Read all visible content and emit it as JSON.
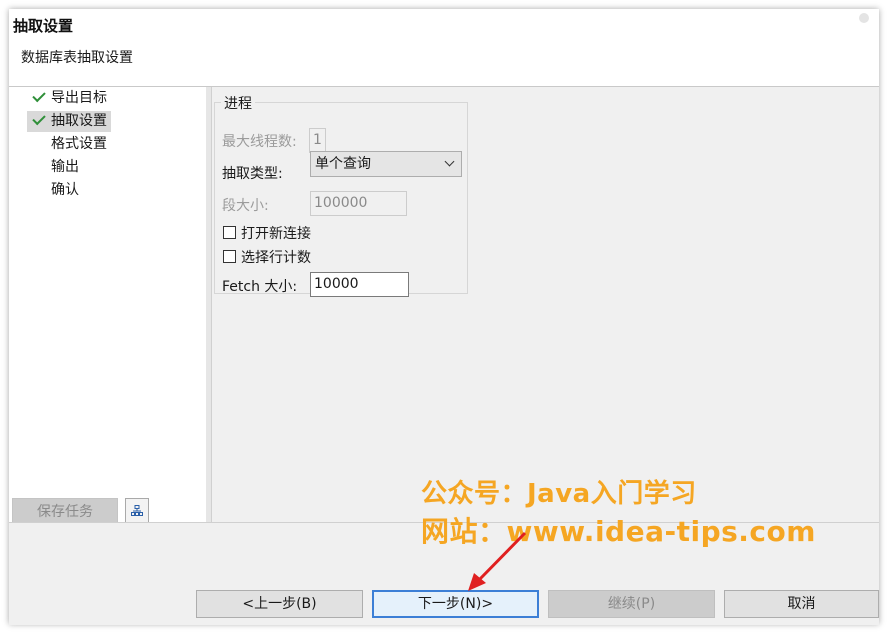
{
  "header": {
    "title": "抽取设置",
    "subtitle": "数据库表抽取设置"
  },
  "nav": {
    "items": [
      {
        "label": "导出目标",
        "checked": true,
        "selected": false
      },
      {
        "label": "抽取设置",
        "checked": true,
        "selected": true
      },
      {
        "label": "格式设置",
        "checked": false,
        "selected": false
      },
      {
        "label": "输出",
        "checked": false,
        "selected": false
      },
      {
        "label": "确认",
        "checked": false,
        "selected": false
      }
    ],
    "save_task_label": "保存任务"
  },
  "process": {
    "group_title": "进程",
    "max_threads_label": "最大线程数:",
    "max_threads_value": "1",
    "extract_type_label": "抽取类型:",
    "extract_type_value": "单个查询",
    "segment_size_label": "段大小:",
    "segment_size_value": "100000",
    "open_new_connection_label": "打开新连接",
    "open_new_connection_checked": false,
    "select_row_count_label": "选择行计数",
    "select_row_count_checked": false,
    "fetch_size_label": "Fetch 大小:",
    "fetch_size_value": "10000"
  },
  "footer": {
    "back_label": "<上一步(B)",
    "next_label": "下一步(N)>",
    "continue_label": "继续(P)",
    "cancel_label": "取消"
  },
  "watermark": {
    "line1": "公众号：Java入门学习",
    "line2": "网站：www.idea-tips.com",
    "color": "#f5a623"
  },
  "colors": {
    "check_green": "#2f8f39",
    "primary_border": "#3c7fd6",
    "arrow_red": "#e02020"
  }
}
